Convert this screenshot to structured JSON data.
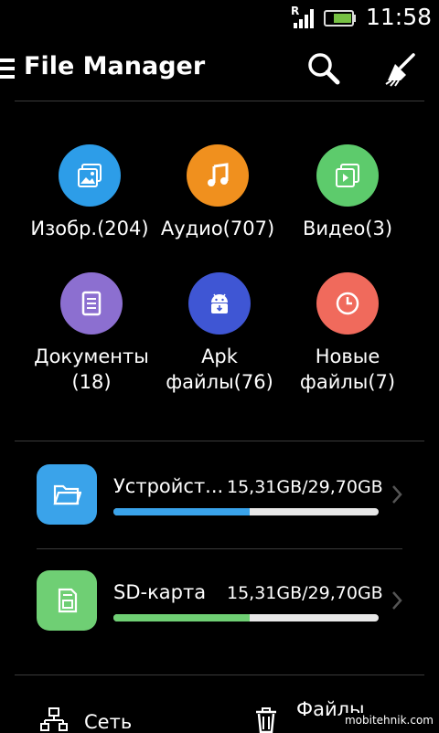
{
  "status_bar": {
    "time": "11:58",
    "roaming": "R"
  },
  "app_bar": {
    "title": "File Manager"
  },
  "categories": [
    {
      "label": "Изобр.(204)",
      "icon": "image-icon",
      "color": "#2d9de8"
    },
    {
      "label": "Аудио(707)",
      "icon": "music-icon",
      "color": "#f0901e"
    },
    {
      "label": "Видео(3)",
      "icon": "video-icon",
      "color": "#5dcb6c"
    },
    {
      "label_line1": "Документы",
      "label_line2": "(18)",
      "icon": "document-icon",
      "color": "#8c6fd0"
    },
    {
      "label_line1": "Apk",
      "label_line2": "файлы(76)",
      "icon": "android-icon",
      "color": "#3f56d4"
    },
    {
      "label_line1": "Новые",
      "label_line2": "файлы(7)",
      "icon": "clock-icon",
      "color": "#f06a5c"
    }
  ],
  "storage": [
    {
      "name": "Устройст...",
      "size": "15,31GB/29,70GB",
      "used_fraction": 0.515,
      "color": "#3aa3ea",
      "icon": "folder-icon"
    },
    {
      "name": "SD-карта",
      "size": "15,31GB/29,70GB",
      "used_fraction": 0.515,
      "color": "#6fcf74",
      "icon": "sd-card-icon"
    }
  ],
  "bottom": {
    "network_label": "Сеть",
    "files_label": "Файлы"
  },
  "watermark": "mobitehnik.com"
}
